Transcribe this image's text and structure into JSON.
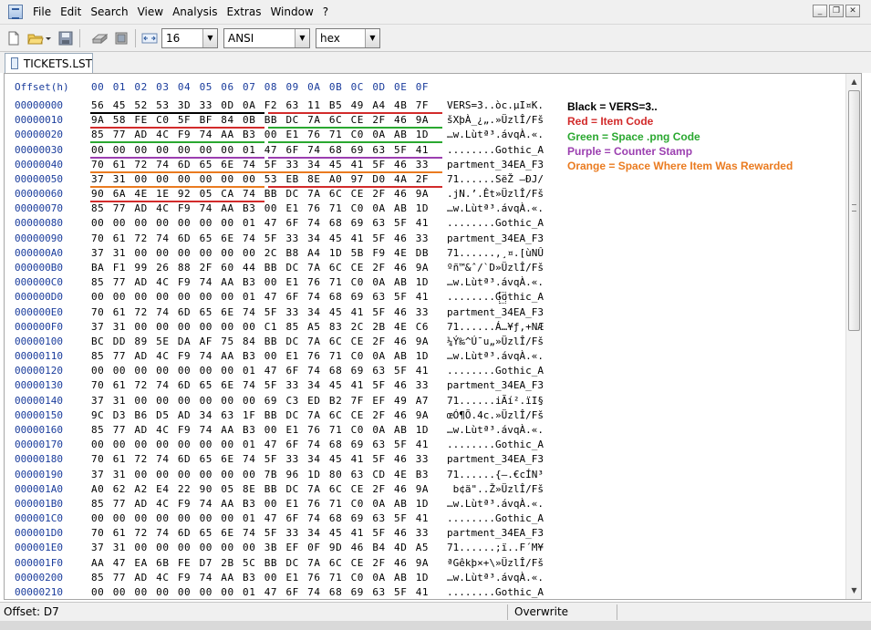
{
  "menu": [
    "File",
    "Edit",
    "Search",
    "View",
    "Analysis",
    "Extras",
    "Window",
    "?"
  ],
  "window_buttons": {
    "minimize": "_",
    "restore": "❐",
    "close": "✕"
  },
  "toolbar": {
    "bytes_per_row": "16",
    "charset": "ANSI",
    "display_mode": "hex"
  },
  "tab": {
    "label": "TICKETS.LST"
  },
  "editor": {
    "offset_header": "Offset(h)",
    "column_header": "00 01 02 03 04 05 06 07 08 09 0A 0B 0C 0D 0E 0F",
    "rows": [
      {
        "offset": "00000000",
        "hex": "56 45 52 53 3D 33 0D 0A F2 63 11 B5 49 A4 4B 7F",
        "ascii": "VERS=3..òc.µI¤K."
      },
      {
        "offset": "00000010",
        "hex": "9A 58 FE C0 5F BF 84 0B BB DC 7A 6C CE 2F 46 9A",
        "ascii": "šXþÀ_¿„.»ÜzlÎ/Fš"
      },
      {
        "offset": "00000020",
        "hex": "85 77 AD 4C F9 74 AA B3 00 E1 76 71 C0 0A AB 1D",
        "ascii": "…w.Lùtª³.ávqÀ.«."
      },
      {
        "offset": "00000030",
        "hex": "00 00 00 00 00 00 00 01 47 6F 74 68 69 63 5F 41",
        "ascii": "........Gothic_A"
      },
      {
        "offset": "00000040",
        "hex": "70 61 72 74 6D 65 6E 74 5F 33 34 45 41 5F 46 33",
        "ascii": "partment_34EA_F3"
      },
      {
        "offset": "00000050",
        "hex": "37 31 00 00 00 00 00 00 53 EB 8E A0 97 D0 4A 2F",
        "ascii": "71......SëŽ —ÐJ/"
      },
      {
        "offset": "00000060",
        "hex": "90 6A 4E 1E 92 05 CA 74 BB DC 7A 6C CE 2F 46 9A",
        "ascii": ".jN.’.Êt»ÜzlÎ/Fš"
      },
      {
        "offset": "00000070",
        "hex": "85 77 AD 4C F9 74 AA B3 00 E1 76 71 C0 0A AB 1D",
        "ascii": "…w.Lùtª³.ávqÀ.«."
      },
      {
        "offset": "00000080",
        "hex": "00 00 00 00 00 00 00 01 47 6F 74 68 69 63 5F 41",
        "ascii": "........Gothic_A"
      },
      {
        "offset": "00000090",
        "hex": "70 61 72 74 6D 65 6E 74 5F 33 34 45 41 5F 46 33",
        "ascii": "partment_34EA_F3"
      },
      {
        "offset": "000000A0",
        "hex": "37 31 00 00 00 00 00 00 2C B8 A4 1D 5B F9 4E DB",
        "ascii": "71......,¸¤.[ùNÛ"
      },
      {
        "offset": "000000B0",
        "hex": "BA F1 99 26 88 2F 60 44 BB DC 7A 6C CE 2F 46 9A",
        "ascii": "ºñ™&ˆ/`D»ÜzlÎ/Fš"
      },
      {
        "offset": "000000C0",
        "hex": "85 77 AD 4C F9 74 AA B3 00 E1 76 71 C0 0A AB 1D",
        "ascii": "…w.Lùtª³.ávqÀ.«."
      },
      {
        "offset": "000000D0",
        "hex": "00 00 00 00 00 00 00 01 47 6F 74 68 69 63 5F 41",
        "ascii": "........Gothic_A"
      },
      {
        "offset": "000000E0",
        "hex": "70 61 72 74 6D 65 6E 74 5F 33 34 45 41 5F 46 33",
        "ascii": "partment_34EA_F3"
      },
      {
        "offset": "000000F0",
        "hex": "37 31 00 00 00 00 00 00 C1 85 A5 83 2C 2B 4E C6",
        "ascii": "71......Á…¥ƒ,+NÆ"
      },
      {
        "offset": "00000100",
        "hex": "BC DD 89 5E DA AF 75 84 BB DC 7A 6C CE 2F 46 9A",
        "ascii": "¼Ý‰^Ú¯u„»ÜzlÎ/Fš"
      },
      {
        "offset": "00000110",
        "hex": "85 77 AD 4C F9 74 AA B3 00 E1 76 71 C0 0A AB 1D",
        "ascii": "…w.Lùtª³.ávqÀ.«."
      },
      {
        "offset": "00000120",
        "hex": "00 00 00 00 00 00 00 01 47 6F 74 68 69 63 5F 41",
        "ascii": "........Gothic_A"
      },
      {
        "offset": "00000130",
        "hex": "70 61 72 74 6D 65 6E 74 5F 33 34 45 41 5F 46 33",
        "ascii": "partment_34EA_F3"
      },
      {
        "offset": "00000140",
        "hex": "37 31 00 00 00 00 00 00 69 C3 ED B2 7F EF 49 A7",
        "ascii": "71......iÃí².ïI§"
      },
      {
        "offset": "00000150",
        "hex": "9C D3 B6 D5 AD 34 63 1F BB DC 7A 6C CE 2F 46 9A",
        "ascii": "œÓ¶Õ.4c.»ÜzlÎ/Fš"
      },
      {
        "offset": "00000160",
        "hex": "85 77 AD 4C F9 74 AA B3 00 E1 76 71 C0 0A AB 1D",
        "ascii": "…w.Lùtª³.ávqÀ.«."
      },
      {
        "offset": "00000170",
        "hex": "00 00 00 00 00 00 00 01 47 6F 74 68 69 63 5F 41",
        "ascii": "........Gothic_A"
      },
      {
        "offset": "00000180",
        "hex": "70 61 72 74 6D 65 6E 74 5F 33 34 45 41 5F 46 33",
        "ascii": "partment_34EA_F3"
      },
      {
        "offset": "00000190",
        "hex": "37 31 00 00 00 00 00 00 7B 96 1D 80 63 CD 4E B3",
        "ascii": "71......{–.€cÍN³"
      },
      {
        "offset": "000001A0",
        "hex": "A0 62 A2 E4 22 90 05 8E BB DC 7A 6C CE 2F 46 9A",
        "ascii": " b¢ä\"..Ž»ÜzlÎ/Fš"
      },
      {
        "offset": "000001B0",
        "hex": "85 77 AD 4C F9 74 AA B3 00 E1 76 71 C0 0A AB 1D",
        "ascii": "…w.Lùtª³.ávqÀ.«."
      },
      {
        "offset": "000001C0",
        "hex": "00 00 00 00 00 00 00 01 47 6F 74 68 69 63 5F 41",
        "ascii": "........Gothic_A"
      },
      {
        "offset": "000001D0",
        "hex": "70 61 72 74 6D 65 6E 74 5F 33 34 45 41 5F 46 33",
        "ascii": "partment_34EA_F3"
      },
      {
        "offset": "000001E0",
        "hex": "37 31 00 00 00 00 00 00 3B EF 0F 9D 46 B4 4D A5",
        "ascii": "71......;ï..F´M¥"
      },
      {
        "offset": "000001F0",
        "hex": "AA 47 EA 6B FE D7 2B 5C BB DC 7A 6C CE 2F 46 9A",
        "ascii": "ªGêkþ×+\\»ÜzlÎ/Fš"
      },
      {
        "offset": "00000200",
        "hex": "85 77 AD 4C F9 74 AA B3 00 E1 76 71 C0 0A AB 1D",
        "ascii": "…w.Lùtª³.ávqÀ.«."
      },
      {
        "offset": "00000210",
        "hex": "00 00 00 00 00 00 00 01 47 6F 74 68 69 63 5F 41",
        "ascii": "........Gothic_A"
      }
    ]
  },
  "legend": [
    {
      "text": "Black = VERS=3..",
      "color": "#000000"
    },
    {
      "text": "Red = Item Code",
      "color": "#d22b2b"
    },
    {
      "text": "Green = Space .png Code",
      "color": "#2aa830"
    },
    {
      "text": "Purple = Counter Stamp",
      "color": "#9b3fb0"
    },
    {
      "text": "Orange = Space Where Item Was Rewarded",
      "color": "#ea7b20"
    }
  ],
  "status": {
    "offset": "Offset: D7",
    "mode": "Overwrite"
  }
}
